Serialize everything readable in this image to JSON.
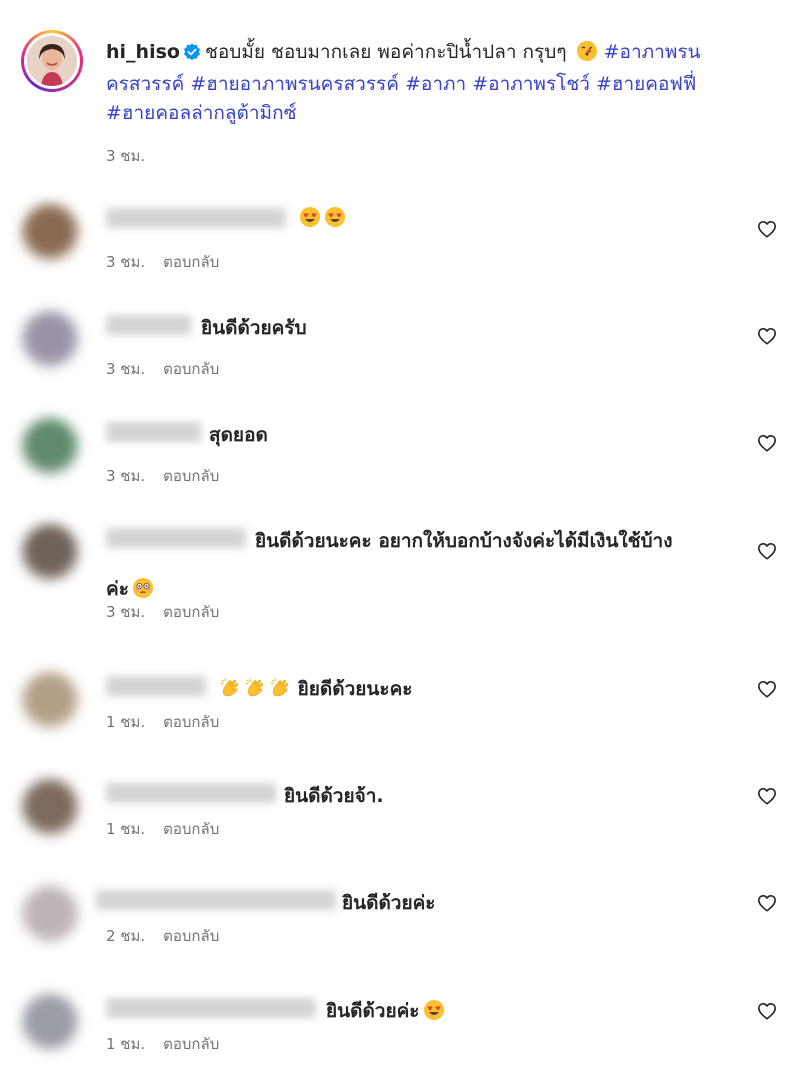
{
  "post": {
    "username": "hi_hiso",
    "caption": "ชอบมั้ย ชอบมากเลย พอค่ากะปิน้ำปลา กรุบๆ",
    "hashtags_line1": "#อาภาพรน",
    "hashtags_line2_pre": "ครสวรรค์",
    "hashtags_line2": "#ฮายอาภาพรนครสวรรค์ #อาภา #อาภาพรโชว์ #ฮายคอฟฟี่",
    "hashtags_line3": "#ฮายคอลล่ากลูต้ามิกซ์",
    "time": "3 ชม."
  },
  "reply_label": "ตอบกลับ",
  "comments": [
    {
      "text": "",
      "time": "3 ชม.",
      "emojis": "heart-eyes heart-eyes",
      "avatar_color": "#8a6b52"
    },
    {
      "text": "ยินดีด้วยครับ",
      "time": "3 ชม.",
      "emojis": "",
      "avatar_color": "#9a93a6"
    },
    {
      "text": "สุดยอด",
      "time": "3 ชม.",
      "emojis": "",
      "avatar_color": "#5f8a6e"
    },
    {
      "text": "ยินดีด้วยนะคะ อยากให้บอกบ้างจังค่ะได้มีเงินใช้บ้าง",
      "text2": "ค่ะ",
      "time": "3 ชม.",
      "emojis": "flushed",
      "avatar_color": "#6e6259"
    },
    {
      "text": "ยิยดีด้วยนะคะ",
      "time": "1 ชม.",
      "emojis": "clap clap clap",
      "avatar_color": "#b3a087"
    },
    {
      "text": "ยินดีด้วยจ้า.",
      "time": "1 ชม.",
      "emojis": "",
      "avatar_color": "#7d6a5d"
    },
    {
      "text": "ยินดีด้วยค่ะ",
      "time": "2 ชม.",
      "emojis": "",
      "avatar_color": "#bdb3b8"
    },
    {
      "text": "ยินดีด้วยค่ะ",
      "time": "1 ชม.",
      "emojis": "heart-eyes",
      "avatar_color": "#9a9ca6"
    }
  ]
}
